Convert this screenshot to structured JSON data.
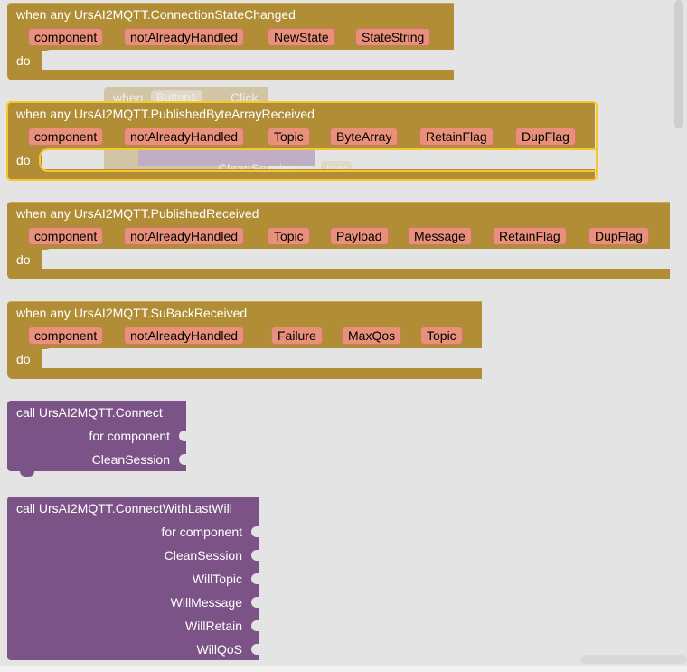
{
  "ghost_block": {
    "when": "when",
    "component": "Button1",
    "event": "Click",
    "call_snippet": "call",
    "clean_session": "CleanSession",
    "value": "true"
  },
  "events": [
    {
      "title": "when any UrsAI2MQTT.ConnectionStateChanged",
      "params": [
        "component",
        "notAlreadyHandled",
        "NewState",
        "StateString"
      ],
      "do": "do",
      "selected": false
    },
    {
      "title": "when any UrsAI2MQTT.PublishedByteArrayReceived",
      "params": [
        "component",
        "notAlreadyHandled",
        "Topic",
        "ByteArray",
        "RetainFlag",
        "DupFlag"
      ],
      "do": "do",
      "selected": true
    },
    {
      "title": "when any UrsAI2MQTT.PublishedReceived",
      "params": [
        "component",
        "notAlreadyHandled",
        "Topic",
        "Payload",
        "Message",
        "RetainFlag",
        "DupFlag"
      ],
      "do": "do",
      "selected": false
    },
    {
      "title": "when any UrsAI2MQTT.SuBackReceived",
      "params": [
        "component",
        "notAlreadyHandled",
        "Failure",
        "MaxQos",
        "Topic"
      ],
      "do": "do",
      "selected": false
    }
  ],
  "calls": [
    {
      "title": "call UrsAI2MQTT.Connect",
      "args": [
        "for component",
        "CleanSession"
      ]
    },
    {
      "title": "call UrsAI2MQTT.ConnectWithLastWill",
      "args": [
        "for component",
        "CleanSession",
        "WillTopic",
        "WillMessage",
        "WillRetain",
        "WillQoS"
      ]
    }
  ],
  "colors": {
    "event_block": "#b18e35",
    "param_chip": "#e8907a",
    "call_block": "#7b5386",
    "selection": "#f7c72e",
    "workspace": "#e4e4e4"
  }
}
